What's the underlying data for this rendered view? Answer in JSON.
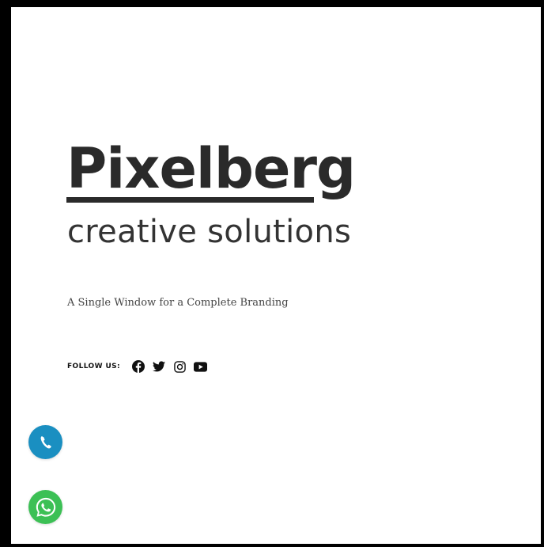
{
  "brand": {
    "name": "Pixelberg",
    "tagline": "creative solutions",
    "subtitle": "A Single Window for a Complete Branding"
  },
  "social": {
    "label": "FOLLOW US:",
    "icons": [
      "facebook-icon",
      "twitter-icon",
      "instagram-icon",
      "youtube-icon"
    ]
  },
  "floating": {
    "call_icon": "phone-icon",
    "call_color": "#1a8fc1",
    "whatsapp_icon": "whatsapp-icon",
    "whatsapp_color": "#3cc055"
  },
  "colors": {
    "text": "#2a2a2a",
    "border": "#000000",
    "background": "#ffffff"
  }
}
